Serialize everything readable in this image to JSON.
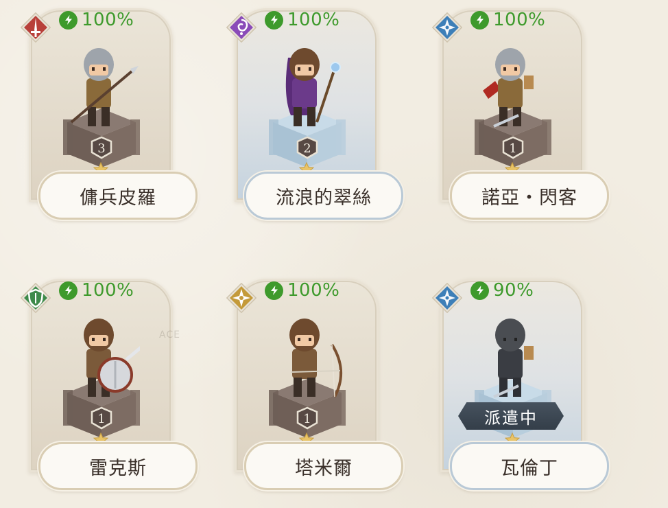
{
  "heroes": [
    {
      "name": "傭兵皮羅",
      "energy": "100%",
      "level": "3",
      "class_icon": "sword-class-icon",
      "class_color": "#b8403a",
      "weapon": "spear",
      "blue": false
    },
    {
      "name": "流浪的翠絲",
      "energy": "100%",
      "level": "2",
      "class_icon": "magic-class-icon",
      "class_color": "#8a4bb8",
      "weapon": "staff",
      "blue": true
    },
    {
      "name": "諾亞‧閃客",
      "energy": "100%",
      "level": "1",
      "class_icon": "shuriken-class-icon",
      "class_color": "#3d7fb8",
      "weapon": "dagger",
      "blue": false
    },
    {
      "name": "雷克斯",
      "energy": "100%",
      "level": "1",
      "class_icon": "shield-class-icon",
      "class_color": "#3d8a4a",
      "weapon": "shield",
      "blue": false
    },
    {
      "name": "塔米爾",
      "energy": "100%",
      "level": "1",
      "class_icon": "star-class-icon",
      "class_color": "#c49a3a",
      "weapon": "bow",
      "blue": false
    },
    {
      "name": "瓦倫丁",
      "energy": "90%",
      "level": "",
      "class_icon": "shuriken-class-icon",
      "class_color": "#3d7fb8",
      "weapon": "dagger",
      "blue": true,
      "status": "派遣中"
    }
  ],
  "colors": {
    "energy_green": "#3e9a2c",
    "star_gold": "#e9c468",
    "pedestal_dark": "#6f5f57",
    "pedestal_blue": "#b8cedd"
  },
  "watermark": "ACE"
}
